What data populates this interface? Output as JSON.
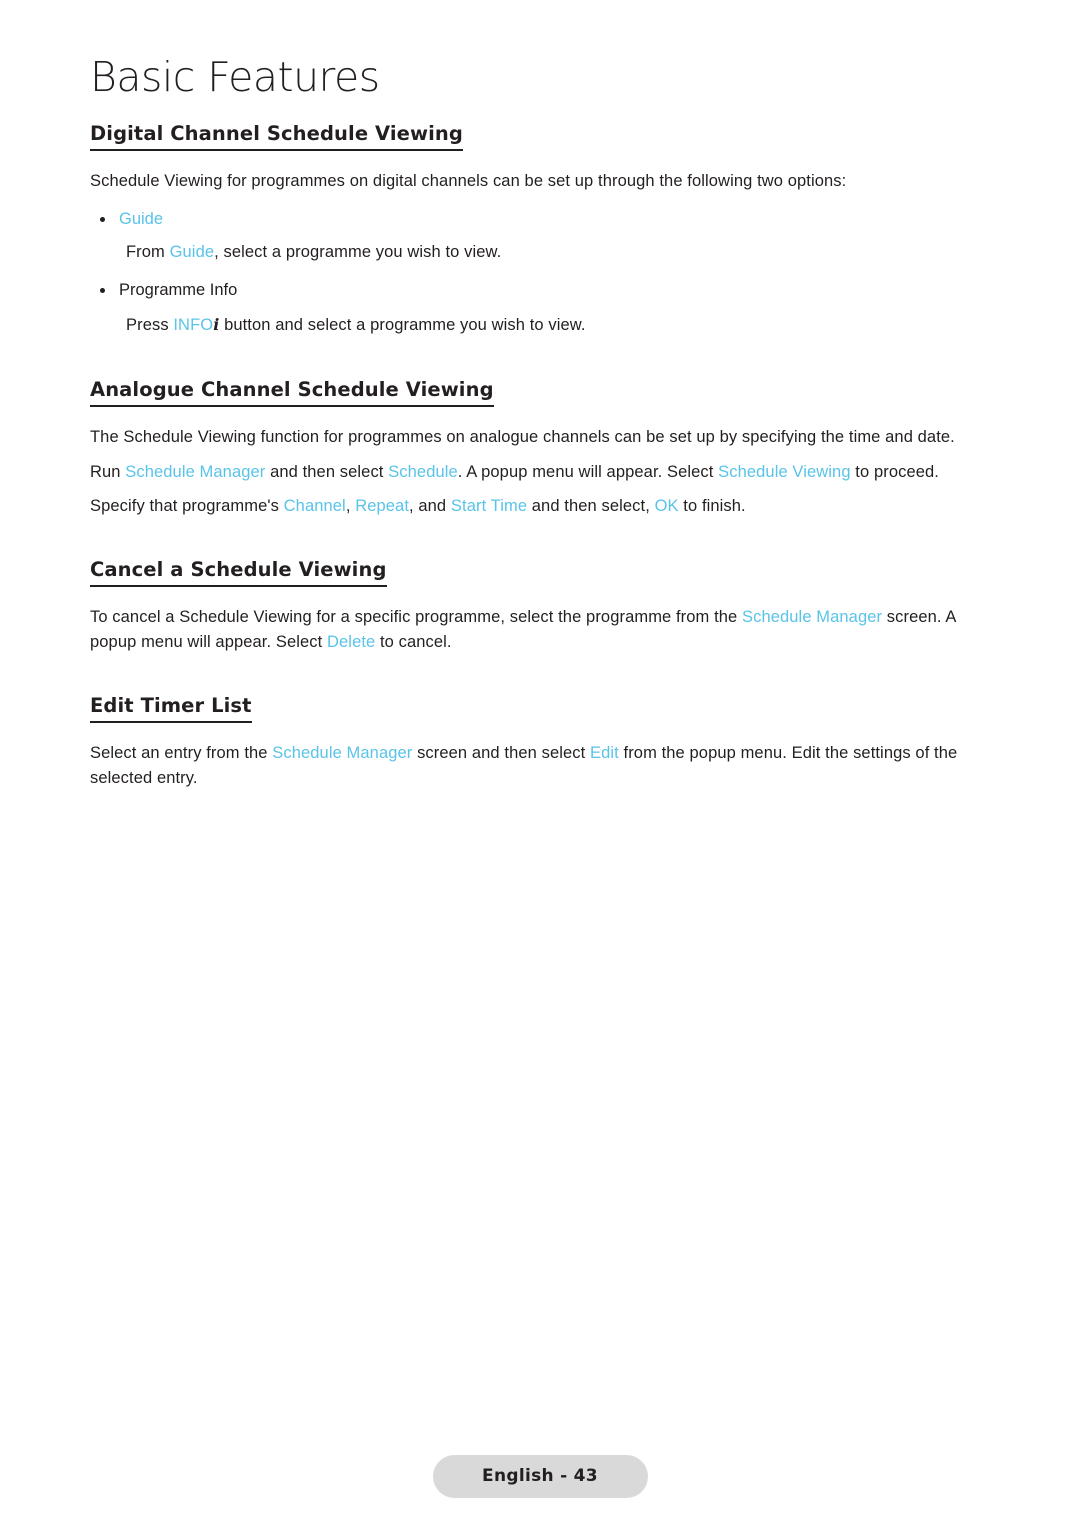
{
  "document": {
    "chapter_title": "Basic Features",
    "accent_color": "#59c3e8",
    "text_color": "#231f20",
    "sections": [
      {
        "heading": "Digital Channel Schedule Viewing",
        "intro": "Schedule Viewing for programmes on digital channels can be set up through the following two options:",
        "bullets": [
          {
            "label": "Guide",
            "label_highlighted": true,
            "detail_prefix": "From ",
            "detail_link": "Guide",
            "detail_suffix": ", select a programme you wish to view."
          },
          {
            "label": "Programme Info",
            "label_highlighted": false,
            "detail_prefix": "Press ",
            "detail_link": "INFO",
            "detail_icon": "i",
            "detail_suffix": " button and select a programme you wish to view."
          }
        ]
      },
      {
        "heading": "Analogue Channel Schedule Viewing",
        "paragraph_1": "The Schedule Viewing function for programmes on analogue channels can be set up by specifying the time and date.",
        "paragraph_2": {
          "p1": "Run ",
          "l1": "Schedule Manager",
          "p2": " and then select ",
          "l2": "Schedule",
          "p3": ". A popup menu will appear. Select ",
          "l3": "Schedule Viewing",
          "p4": " to proceed."
        },
        "paragraph_3": {
          "p1": "Specify that programme's ",
          "l1": "Channel",
          "p2": ", ",
          "l2": "Repeat",
          "p3": ", and ",
          "l3": "Start Time",
          "p4": " and then select, ",
          "l4": "OK",
          "p5": " to finish."
        }
      },
      {
        "heading": "Cancel a Schedule Viewing",
        "paragraph": {
          "p1": "To cancel a Schedule Viewing for a specific programme, select the programme from the ",
          "l1": "Schedule Manager",
          "p2": " screen. A popup menu will appear. Select ",
          "l2": "Delete",
          "p3": " to cancel."
        }
      },
      {
        "heading": "Edit Timer List",
        "paragraph": {
          "p1": "Select an entry from the ",
          "l1": "Schedule Manager",
          "p2": " screen and then select ",
          "l2": "Edit",
          "p3": " from the popup menu. Edit the settings of the selected entry."
        }
      }
    ],
    "footer": {
      "page_label": "English - 43"
    }
  }
}
